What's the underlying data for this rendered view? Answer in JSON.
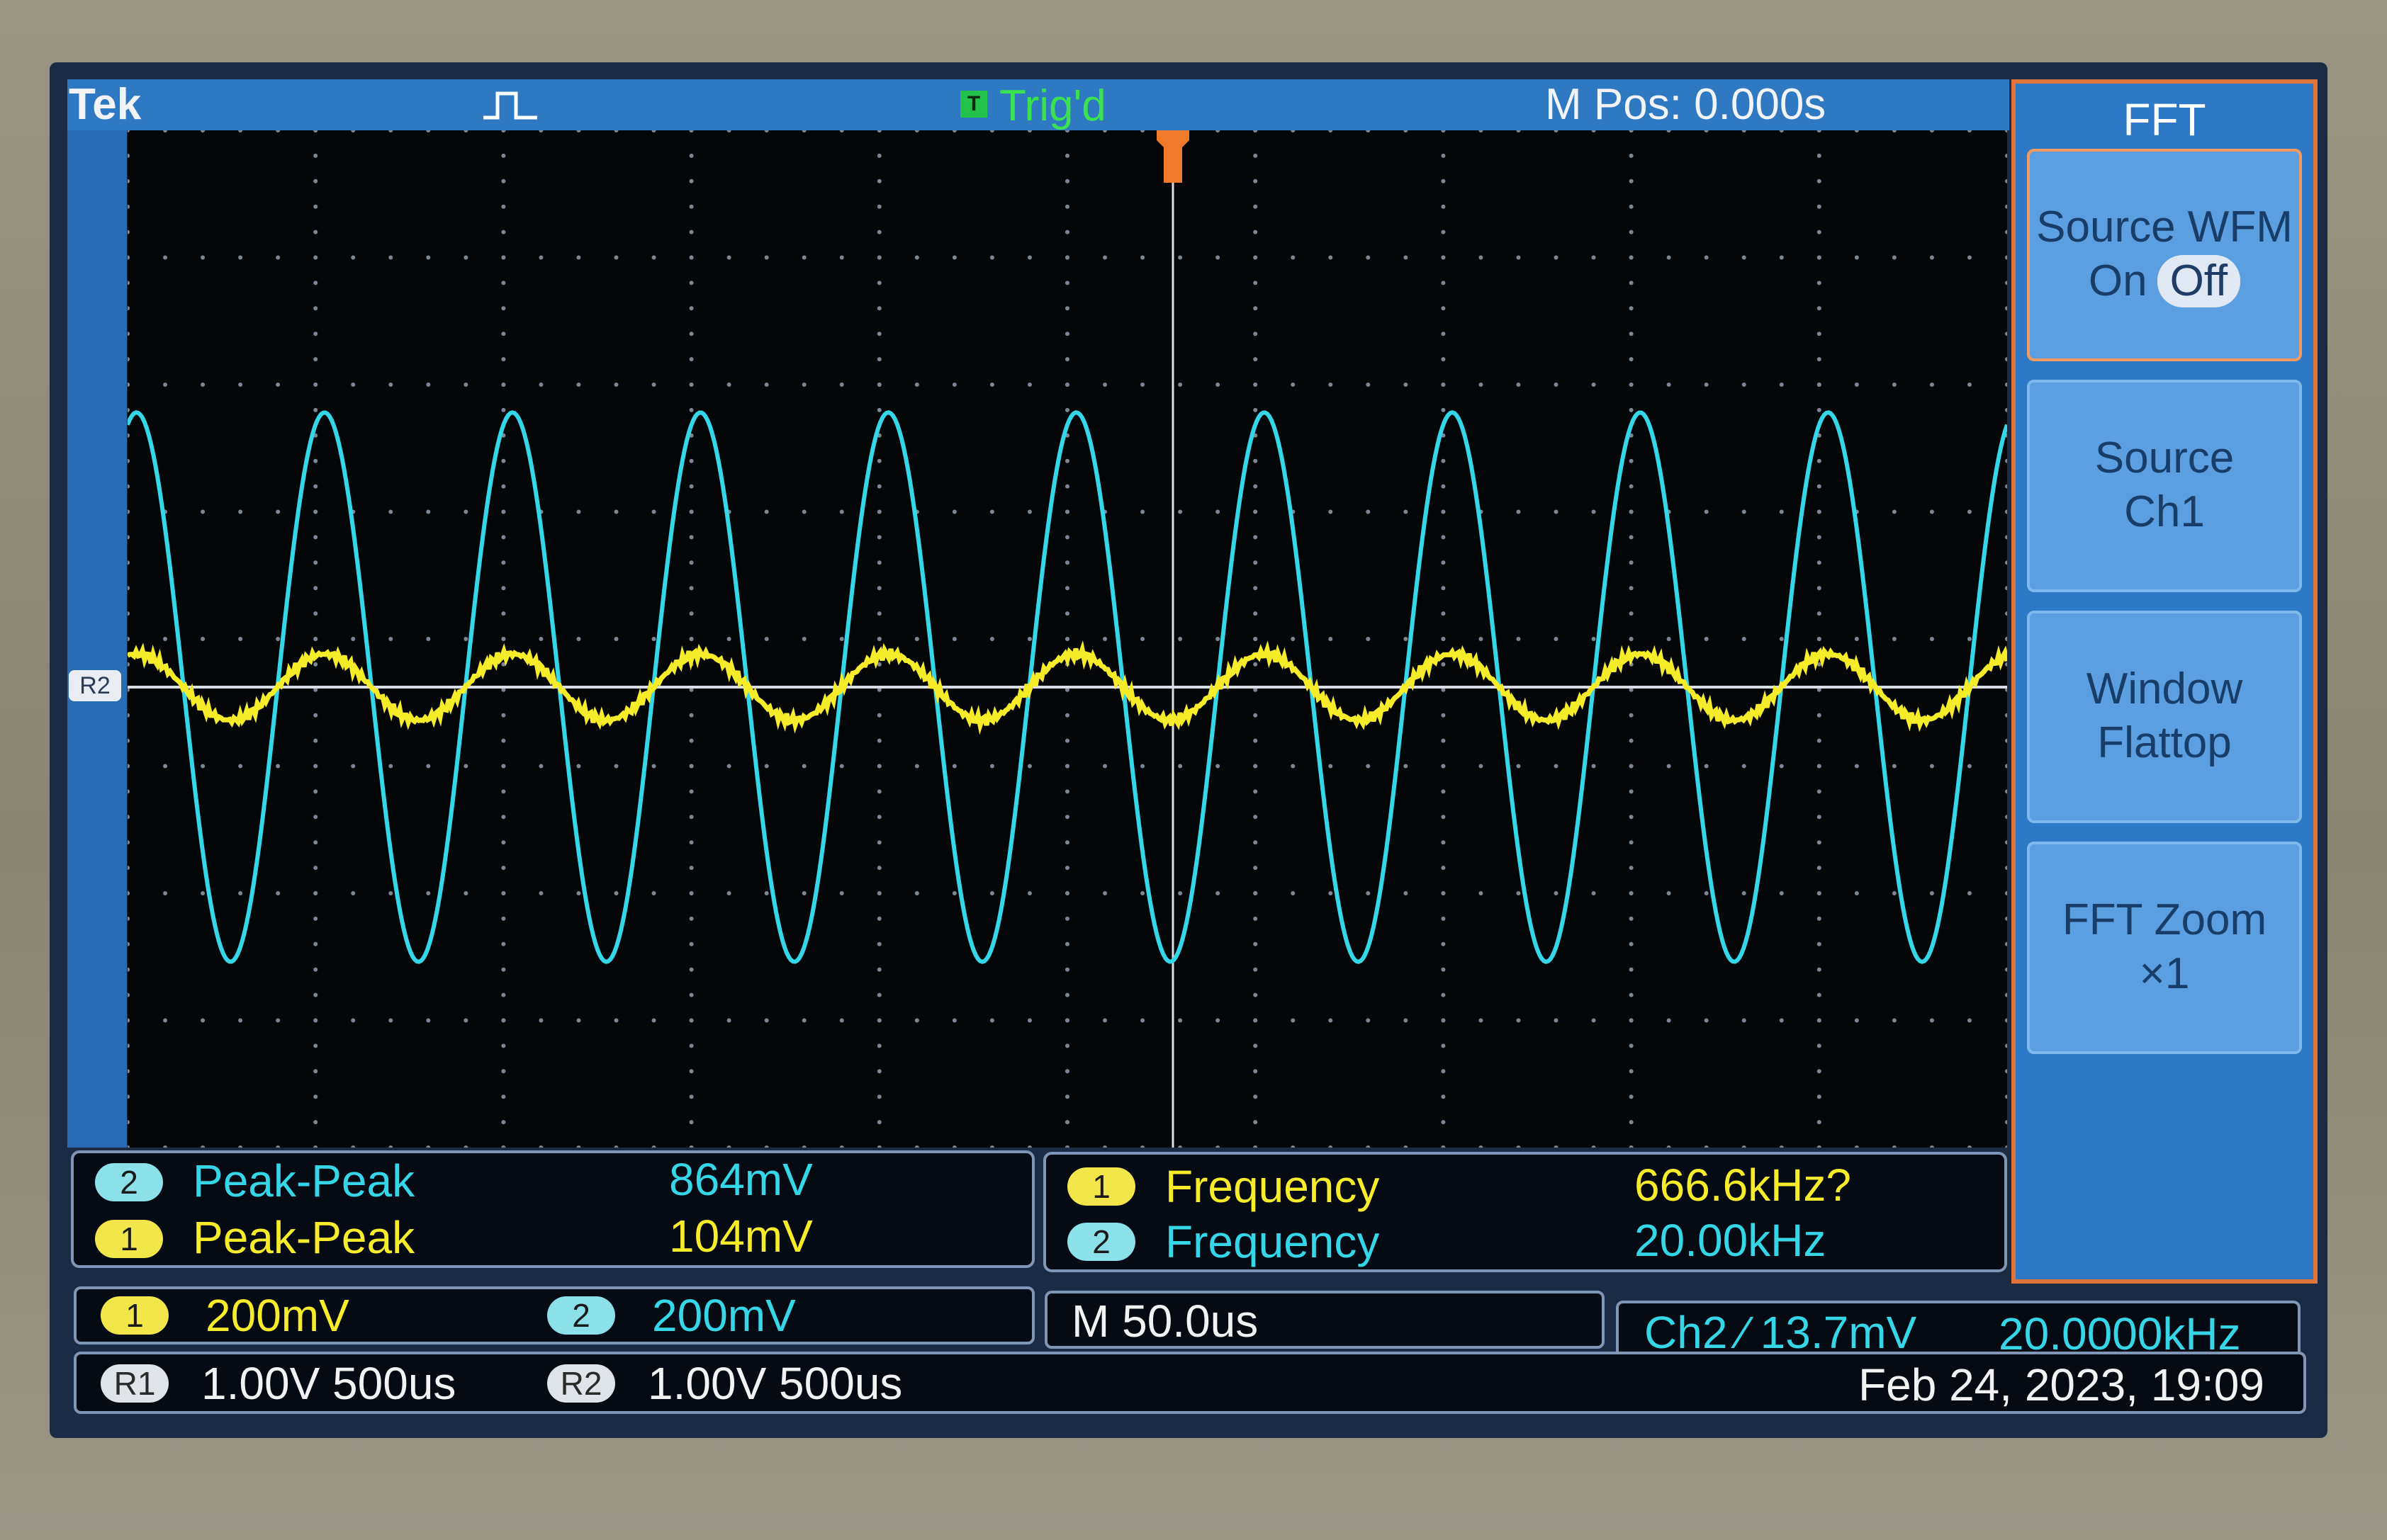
{
  "header": {
    "brand": "Tek",
    "trigger_status": "Trig'd",
    "trigger_badge": "T",
    "horizontal_position": "M Pos: 0.000s"
  },
  "side_menu": {
    "title": "FFT",
    "buttons": [
      {
        "line1": "Source WFM",
        "line2_on": "On",
        "line2_off": "Off",
        "selected": "Off"
      },
      {
        "line1": "Source",
        "line2": "Ch1"
      },
      {
        "line1": "Window",
        "line2": "Flattop"
      },
      {
        "line1": "FFT Zoom",
        "line2": "×1"
      }
    ]
  },
  "reference_marker": "R2",
  "measurements": [
    {
      "channel": "2",
      "label": "Peak-Peak",
      "value": "864mV"
    },
    {
      "channel": "1",
      "label": "Peak-Peak",
      "value": "104mV"
    },
    {
      "channel": "1",
      "label": "Frequency",
      "value": "666.6kHz?"
    },
    {
      "channel": "2",
      "label": "Frequency",
      "value": "20.00kHz"
    }
  ],
  "status": {
    "ch1_badge": "1",
    "ch1_scale": "200mV",
    "ch2_badge": "2",
    "ch2_scale": "200mV",
    "timebase": "M 50.0us",
    "trigger_info": "Ch2 ⁄ 13.7mV",
    "trigger_frequency": "20.0000kHz",
    "r1_badge": "R1",
    "r1_setting": "1.00V 500us",
    "r2_badge": "R2",
    "r2_setting": "1.00V 500us",
    "datetime": "Feb 24, 2023, 19:09"
  },
  "colors": {
    "ch1": "#f7ec2a",
    "ch2": "#35d6e8",
    "screen_bg": "#050608",
    "menu_bg": "#2d79c6",
    "menu_border": "#e0753c"
  },
  "chart_data": {
    "type": "line",
    "title": "",
    "x_divisions": 10,
    "y_divisions": 8,
    "timebase": "50.0us/div",
    "series": [
      {
        "name": "2",
        "waveform": "sine",
        "frequency_hz": 20000,
        "peak_to_peak_v": 0.864,
        "volts_per_div": 0.2,
        "color": "#35d6e8"
      },
      {
        "name": "1",
        "waveform": "sine",
        "frequency_hz": 20000,
        "peak_to_peak_v": 0.104,
        "volts_per_div": 0.2,
        "color": "#f7ec2a"
      }
    ]
  }
}
